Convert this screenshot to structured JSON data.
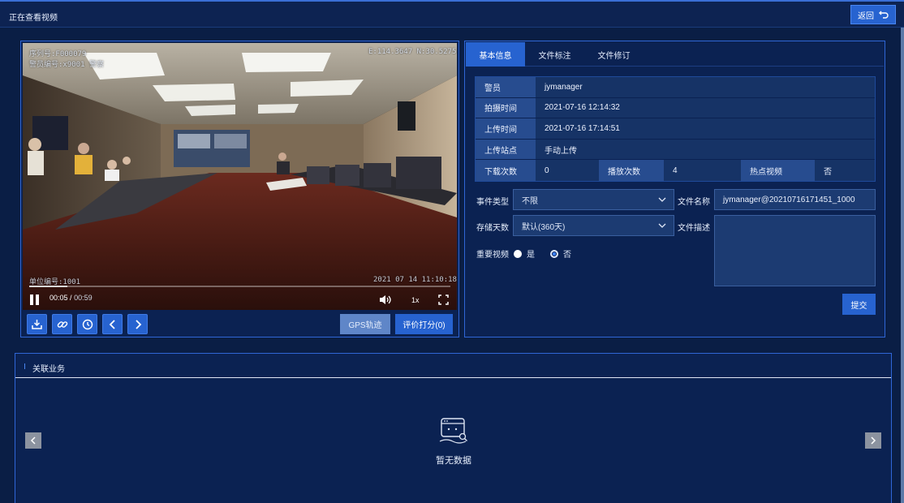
{
  "header": {
    "title": "正在查看视频",
    "back_label": "返回"
  },
  "video": {
    "osd_serial": "序列号:F000079",
    "osd_officer": "警员编号:x9001 警察",
    "osd_coords": "E:114.3647 N:30.5275",
    "osd_unit": "单位编号:1001",
    "osd_datetime": "2021 07 14 11:10:18",
    "current_time": "00:05",
    "time_sep": "/",
    "total_time": "00:59",
    "speed": "1x",
    "progress": 0.09
  },
  "video_toolbar": {
    "gps_label": "GPS轨迹",
    "eval_label": "评价打分(0)"
  },
  "tabs": [
    {
      "label": "基本信息",
      "active": true
    },
    {
      "label": "文件标注",
      "active": false
    },
    {
      "label": "文件修订",
      "active": false
    }
  ],
  "info": {
    "officer_label": "警员",
    "officer_value": "jymanager",
    "shoot_time_label": "拍摄时间",
    "shoot_time_value": "2021-07-16 12:14:32",
    "upload_time_label": "上传时间",
    "upload_time_value": "2021-07-16 17:14:51",
    "upload_site_label": "上传站点",
    "upload_site_value": "手动上传",
    "download_count_label": "下载次数",
    "download_count_value": "0",
    "play_count_label": "播放次数",
    "play_count_value": "4",
    "hot_label": "热点视频",
    "hot_value": "否"
  },
  "form": {
    "event_type_label": "事件类型",
    "event_type_value": "不限",
    "file_name_label": "文件名称",
    "file_name_value": "jymanager@20210716171451_1000",
    "storage_days_label": "存储天数",
    "storage_days_value": "默认(360天)",
    "file_desc_label": "文件描述",
    "important_label": "重要视频",
    "yes_label": "是",
    "no_label": "否",
    "important_selected": "否",
    "submit_label": "提交"
  },
  "related": {
    "title": "关联业务",
    "empty_text": "暂无数据"
  },
  "colors": {
    "accent": "#2763d0",
    "panel_bg": "#0b2252",
    "page_bg": "#0a1e45",
    "border": "#2f66d6"
  }
}
